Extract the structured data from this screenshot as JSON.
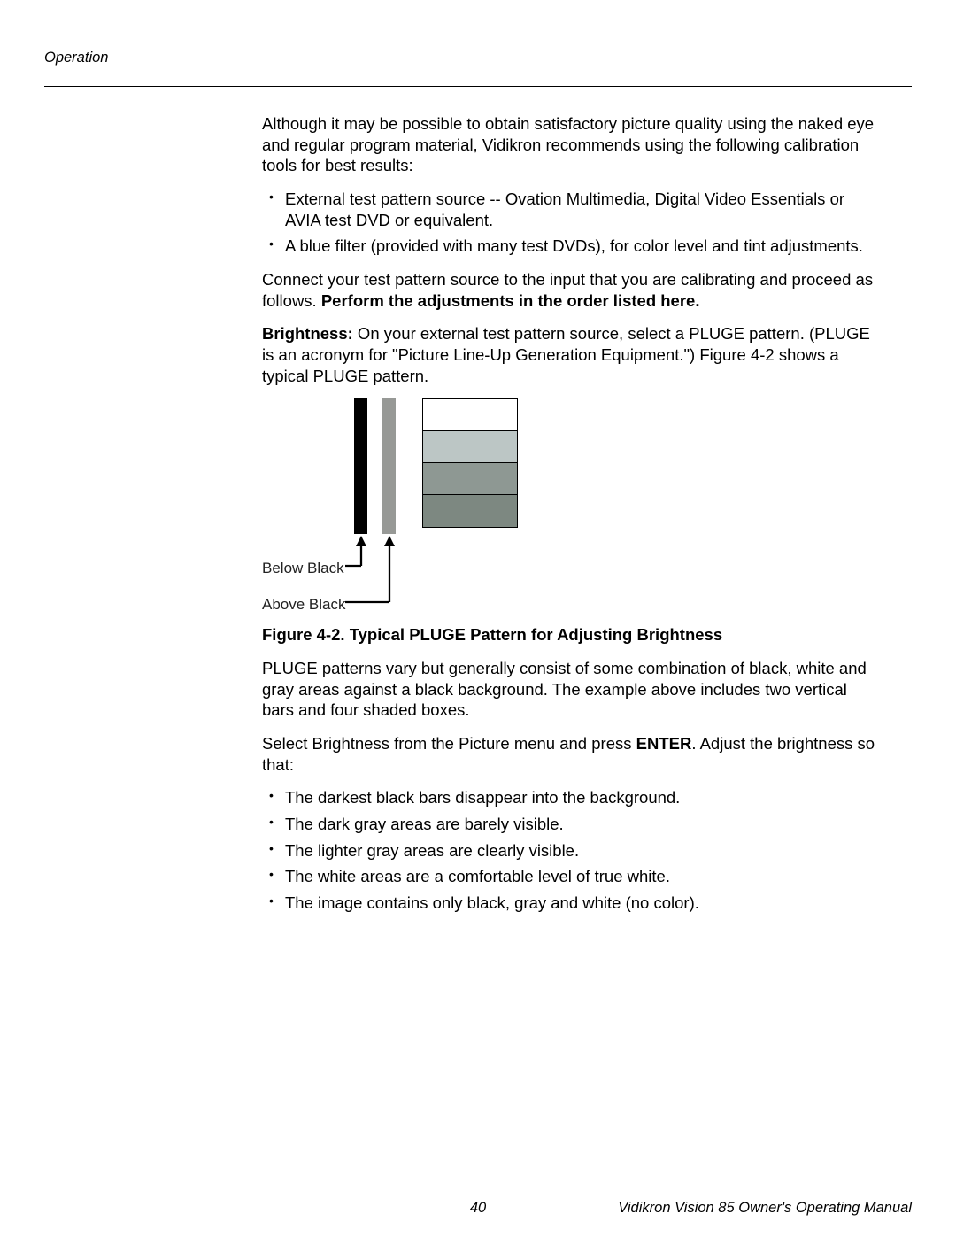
{
  "header": {
    "section": "Operation"
  },
  "body": {
    "intro": "Although it may be possible to obtain satisfactory picture quality using the naked eye and regular program material, Vidikron recommends using the following calibration tools for best results:",
    "tools": [
      "External test pattern source -- Ovation Multimedia, Digital Video Essentials or AVIA test DVD or equivalent.",
      "A blue filter (provided with many test DVDs), for color level and tint adjustments."
    ],
    "connect_line": "Connect your test pattern source to the input that you are calibrating and proceed as follows. ",
    "connect_bold": "Perform the adjustments in the order listed here.",
    "brightness_label": "Brightness:",
    "brightness_text": " On your external test pattern source, select a PLUGE pattern. (PLUGE is an acronym for \"Picture Line-Up Generation Equipment.\") Figure 4-2 shows a typical PLUGE pattern.",
    "figure": {
      "below_black": "Below Black",
      "above_black": "Above Black",
      "caption": "Figure 4-2. Typical PLUGE Pattern for Adjusting Brightness"
    },
    "pluge_desc": "PLUGE patterns vary but generally consist of some combination of black, white and gray areas against a black background. The example above includes two vertical bars and four shaded boxes.",
    "select_line_pre": "Select Brightness from the Picture menu and press ",
    "select_line_bold": "ENTER",
    "select_line_post": ". Adjust the brightness so that:",
    "adjust_list": [
      "The darkest black bars disappear into the background.",
      "The dark gray areas are barely visible.",
      "The lighter gray areas are clearly visible.",
      "The white areas are a comfortable level of true white.",
      "The image contains only black, gray and white (no color)."
    ]
  },
  "footer": {
    "page_number": "40",
    "doc_title": "Vidikron Vision 85 Owner's Operating Manual"
  }
}
